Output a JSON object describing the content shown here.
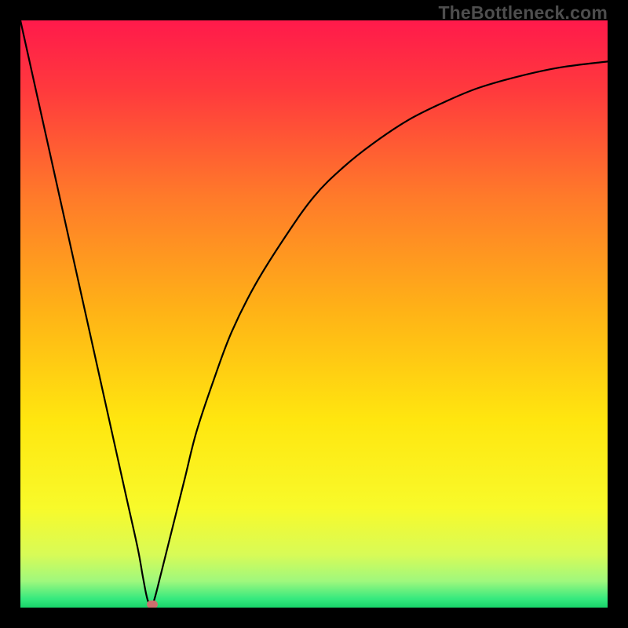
{
  "watermark": "TheBottleneck.com",
  "chart_data": {
    "type": "line",
    "title": "",
    "xlabel": "",
    "ylabel": "",
    "xlim": [
      0,
      100
    ],
    "ylim": [
      0,
      100
    ],
    "grid": false,
    "legend": false,
    "gradient_stops": [
      {
        "offset": 0.0,
        "color": "#ff1a4b"
      },
      {
        "offset": 0.12,
        "color": "#ff3a3d"
      },
      {
        "offset": 0.3,
        "color": "#ff7a2a"
      },
      {
        "offset": 0.5,
        "color": "#ffb416"
      },
      {
        "offset": 0.68,
        "color": "#ffe60f"
      },
      {
        "offset": 0.83,
        "color": "#f8fa2a"
      },
      {
        "offset": 0.91,
        "color": "#d8fb57"
      },
      {
        "offset": 0.955,
        "color": "#9ff87d"
      },
      {
        "offset": 0.985,
        "color": "#36e97e"
      },
      {
        "offset": 1.0,
        "color": "#18d46a"
      }
    ],
    "series": [
      {
        "name": "bottleneck-curve",
        "x": [
          0,
          2,
          4,
          6,
          8,
          10,
          12,
          14,
          16,
          18,
          20,
          20.9,
          21.7,
          22.5,
          24,
          26,
          28,
          30,
          33,
          36,
          40,
          45,
          50,
          55,
          60,
          66,
          72,
          78,
          85,
          92,
          100
        ],
        "values": [
          100,
          91,
          82,
          73,
          64,
          55,
          46,
          37,
          28,
          19,
          10,
          5,
          1.2,
          0.5,
          6,
          14,
          22,
          30,
          39,
          47,
          55,
          63,
          70,
          75,
          79,
          83,
          86,
          88.5,
          90.5,
          92,
          93
        ]
      }
    ],
    "marker": {
      "x": 22.5,
      "y": 0.5
    },
    "frame_color": "#000000"
  }
}
